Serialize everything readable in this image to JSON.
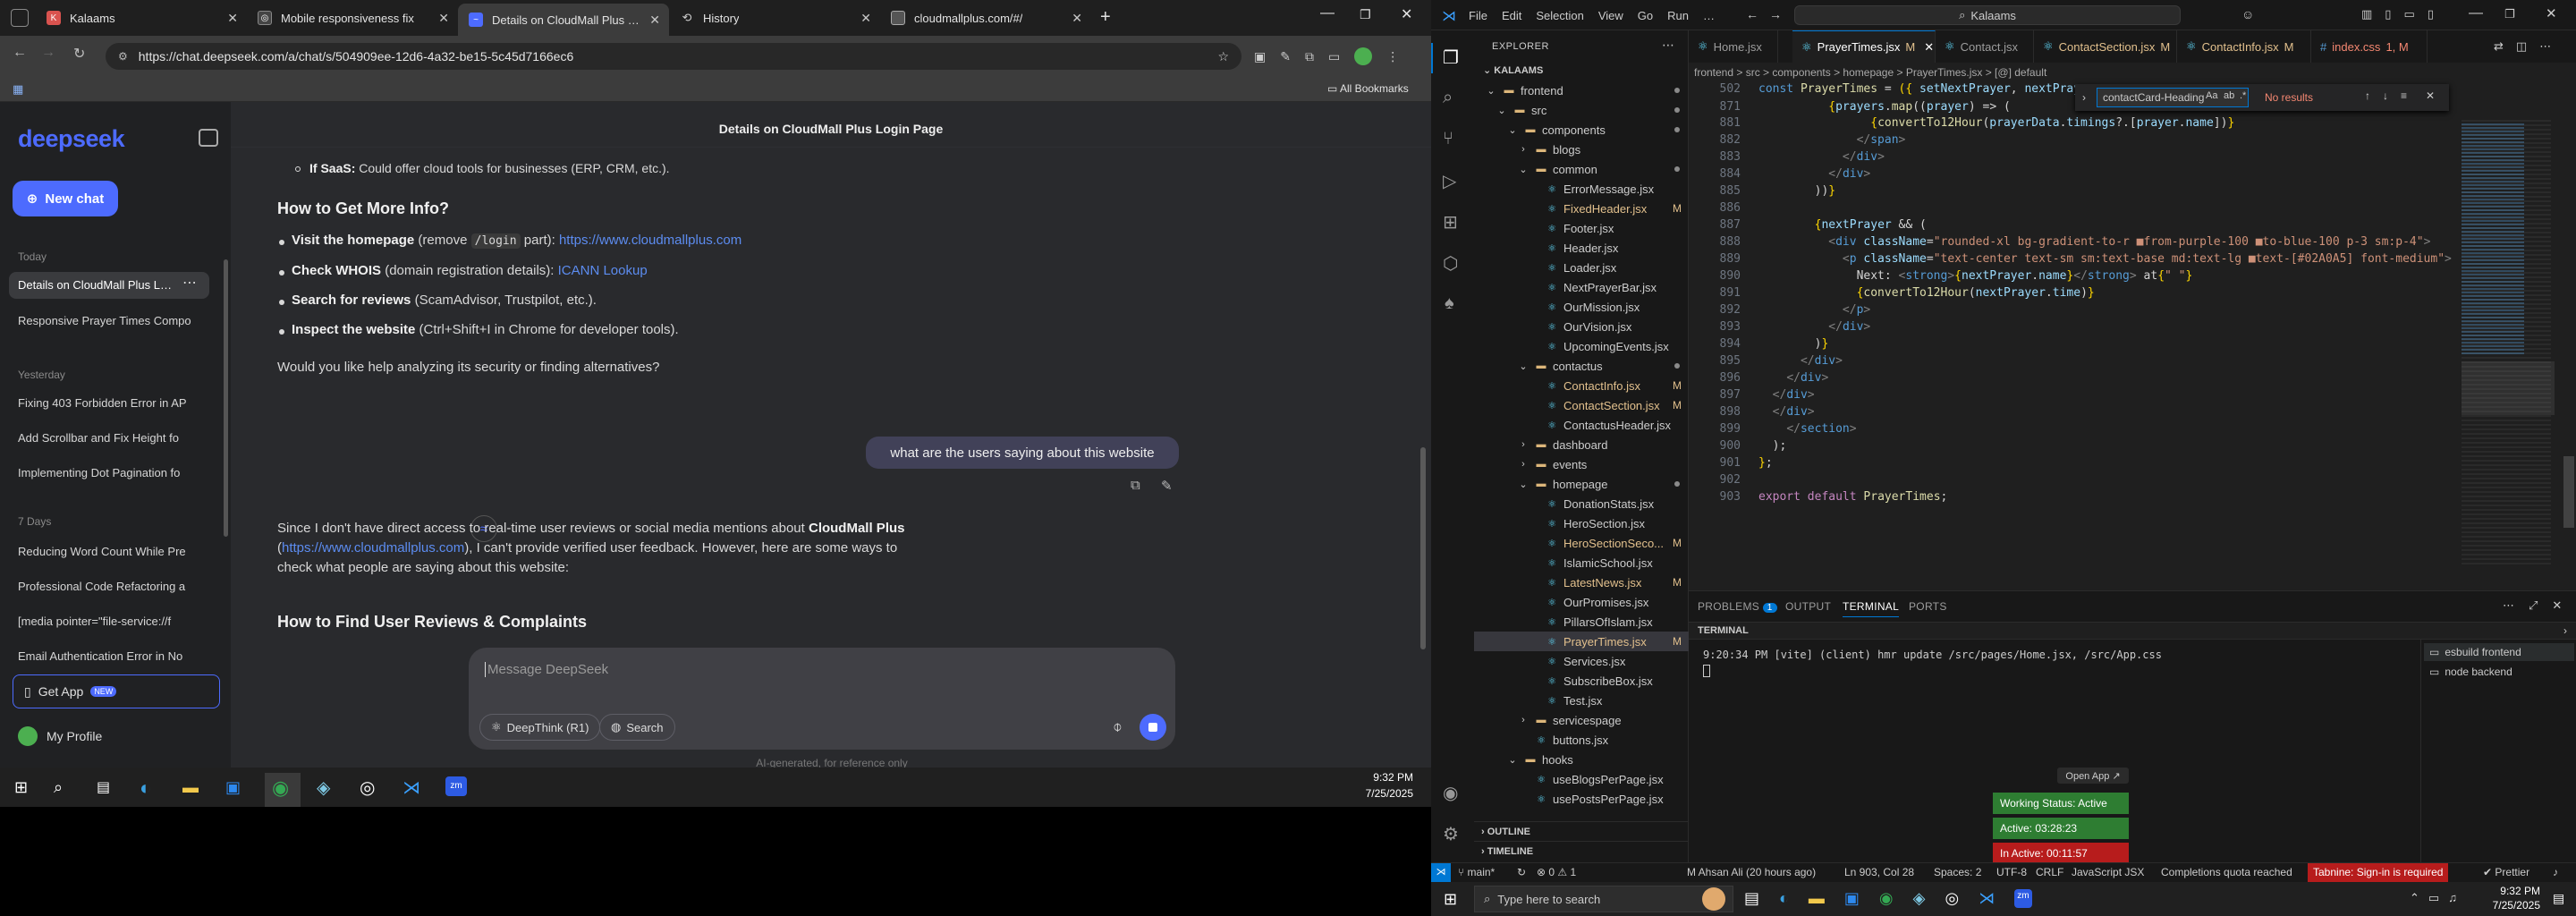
{
  "chrome": {
    "tabs": [
      {
        "title": "Kalaams"
      },
      {
        "title": "Mobile responsiveness fix"
      },
      {
        "title": "Details on CloudMall Plus Login Page"
      },
      {
        "title": "History"
      },
      {
        "title": "cloudmallplus.com/#/"
      }
    ],
    "url": "https://chat.deepseek.com/a/chat/s/504909ee-12d6-4a32-be15-5c45d7166ec6",
    "bookmarks_label": "All Bookmarks"
  },
  "deepseek": {
    "logo": "deepseek",
    "new_chat": "New chat",
    "sections": {
      "today": "Today",
      "yesterday": "Yesterday",
      "week": "7 Days"
    },
    "today_chats": [
      "Details on CloudMall Plus Login",
      "Responsive Prayer Times Compo"
    ],
    "yesterday_chats": [
      "Fixing 403 Forbidden Error in AP",
      "Add Scrollbar and Fix Height fo",
      "Implementing Dot Pagination fo"
    ],
    "week_chats": [
      "Reducing Word Count While Pre",
      "Professional Code Refactoring a",
      "[media pointer=\"file-service://f",
      "Email Authentication Error in No"
    ],
    "get_app": "Get App",
    "new_badge": "NEW",
    "profile": "My Profile",
    "chat_title": "Details on CloudMall Plus Login Page",
    "saas_line_bold": "If SaaS:",
    "saas_line": " Could offer cloud tools for businesses (ERP, CRM, etc.).",
    "heading1": "How to Get More Info?",
    "b1_bold": "Visit the homepage",
    "b1_a": " (remove ",
    "b1_code": "/login",
    "b1_b": " part): ",
    "b1_link": "https://www.cloudmallplus.com",
    "b2_bold": "Check WHOIS",
    "b2_a": " (domain registration details): ",
    "b2_link": "ICANN Lookup",
    "b3_bold": "Search for reviews",
    "b3_a": " (ScamAdvisor, Trustpilot, etc.).",
    "b4_bold": "Inspect the website",
    "b4_a": " (Ctrl+Shift+I in Chrome for developer tools).",
    "question": "Would you like help analyzing its security or finding alternatives?",
    "user_msg": "what are the users saying about this website",
    "reply_a": "Since I don't have direct access to real-time user reviews or social media mentions about ",
    "reply_bold": "CloudMall Plus",
    "reply_b1": "(",
    "reply_link": "https://www.cloudmallplus.com",
    "reply_b2": "), I can't provide verified user feedback. However, here are some ways to",
    "reply_c": "check what people are saying about this website:",
    "heading2": "How to Find User Reviews & Complaints",
    "input_placeholder": "Message DeepSeek",
    "deepthink": "DeepThink (R1)",
    "search": "Search",
    "footer": "AI-generated, for reference only"
  },
  "taskbar_left": {
    "time": "9:32 PM",
    "date": "7/25/2025"
  },
  "vscode": {
    "title_search": "Kalaams",
    "menu": [
      "File",
      "Edit",
      "Selection",
      "View",
      "Go",
      "Run",
      "…"
    ],
    "explorer_label": "EXPLORER",
    "root": "KALAAMS",
    "tree": [
      {
        "name": "frontend",
        "type": "folder",
        "depth": 1,
        "open": true,
        "dot": true
      },
      {
        "name": "src",
        "type": "folder",
        "depth": 2,
        "open": true,
        "dot": true
      },
      {
        "name": "components",
        "type": "folder",
        "depth": 3,
        "open": true,
        "dot": true
      },
      {
        "name": "blogs",
        "type": "folder",
        "depth": 4,
        "open": false
      },
      {
        "name": "common",
        "type": "folder",
        "depth": 4,
        "open": true,
        "dot": true
      },
      {
        "name": "ErrorMessage.jsx",
        "type": "file",
        "depth": 5
      },
      {
        "name": "FixedHeader.jsx",
        "type": "file",
        "depth": 5,
        "mod": "M"
      },
      {
        "name": "Footer.jsx",
        "type": "file",
        "depth": 5
      },
      {
        "name": "Header.jsx",
        "type": "file",
        "depth": 5
      },
      {
        "name": "Loader.jsx",
        "type": "file",
        "depth": 5
      },
      {
        "name": "NextPrayerBar.jsx",
        "type": "file",
        "depth": 5
      },
      {
        "name": "OurMission.jsx",
        "type": "file",
        "depth": 5
      },
      {
        "name": "OurVision.jsx",
        "type": "file",
        "depth": 5
      },
      {
        "name": "UpcomingEvents.jsx",
        "type": "file",
        "depth": 5
      },
      {
        "name": "contactus",
        "type": "folder",
        "depth": 4,
        "open": true,
        "dot": true
      },
      {
        "name": "ContactInfo.jsx",
        "type": "file",
        "depth": 5,
        "mod": "M"
      },
      {
        "name": "ContactSection.jsx",
        "type": "file",
        "depth": 5,
        "mod": "M"
      },
      {
        "name": "ContactusHeader.jsx",
        "type": "file",
        "depth": 5
      },
      {
        "name": "dashboard",
        "type": "folder",
        "depth": 4,
        "open": false
      },
      {
        "name": "events",
        "type": "folder",
        "depth": 4,
        "open": false
      },
      {
        "name": "homepage",
        "type": "folder",
        "depth": 4,
        "open": true,
        "dot": true
      },
      {
        "name": "DonationStats.jsx",
        "type": "file",
        "depth": 5
      },
      {
        "name": "HeroSection.jsx",
        "type": "file",
        "depth": 5
      },
      {
        "name": "HeroSectionSeco...",
        "type": "file",
        "depth": 5,
        "mod": "M"
      },
      {
        "name": "IslamicSchool.jsx",
        "type": "file",
        "depth": 5
      },
      {
        "name": "LatestNews.jsx",
        "type": "file",
        "depth": 5,
        "mod": "M"
      },
      {
        "name": "OurPromises.jsx",
        "type": "file",
        "depth": 5
      },
      {
        "name": "PillarsOfIslam.jsx",
        "type": "file",
        "depth": 5
      },
      {
        "name": "PrayerTimes.jsx",
        "type": "file",
        "depth": 5,
        "mod": "M",
        "selected": true
      },
      {
        "name": "Services.jsx",
        "type": "file",
        "depth": 5
      },
      {
        "name": "SubscribeBox.jsx",
        "type": "file",
        "depth": 5
      },
      {
        "name": "Test.jsx",
        "type": "file",
        "depth": 5
      },
      {
        "name": "servicespage",
        "type": "folder",
        "depth": 4,
        "open": false
      },
      {
        "name": "buttons.jsx",
        "type": "file",
        "depth": 4
      },
      {
        "name": "hooks",
        "type": "folder",
        "depth": 3,
        "open": true
      },
      {
        "name": "useBlogsPerPage.jsx",
        "type": "file",
        "depth": 4
      },
      {
        "name": "usePostsPerPage.jsx",
        "type": "file",
        "depth": 4
      }
    ],
    "outline": "OUTLINE",
    "timeline": "TIMELINE",
    "tabs": [
      {
        "name": "Home.jsx",
        "mod": ""
      },
      {
        "name": "PrayerTimes.jsx",
        "mod": "M"
      },
      {
        "name": "Contact.jsx",
        "mod": ""
      },
      {
        "name": "ContactSection.jsx",
        "mod": "M"
      },
      {
        "name": "ContactInfo.jsx",
        "mod": "M"
      },
      {
        "name": "index.css",
        "mod": "1, M"
      }
    ],
    "breadcrumb": "frontend > src > components > homepage > PrayerTimes.jsx > [@] default",
    "find_text": "contactCard-Heading",
    "find_result": "No results",
    "panel_tabs": [
      "PROBLEMS",
      "OUTPUT",
      "TERMINAL",
      "PORTS"
    ],
    "problems_count": "1",
    "terminal_label": "TERMINAL",
    "terminal_line": "9:20:34 PM [vite] (client) hmr update /src/pages/Home.jsx, /src/App.css",
    "terminal_tabs": [
      "esbuild frontend",
      "node backend"
    ],
    "status": {
      "branch": "main*",
      "errors": "⊗ 0 ⚠ 1",
      "blame": "M Ahsan Ali (20 hours ago)",
      "pos": "Ln 903, Col 28",
      "spaces": "Spaces: 2",
      "encoding": "UTF-8",
      "eol": "CRLF",
      "lang": "JavaScript JSX",
      "completions": "Completions quota reached",
      "tabnine": "Tabnine: Sign-in is required",
      "prettier": "✔ Prettier"
    },
    "widget": {
      "open": "Open App ↗",
      "status": "Working Status: Active",
      "active": "Active: 03:28:23",
      "inactive": "In Active: 00:11:57"
    }
  },
  "taskbar_right": {
    "search": "Type here to search",
    "time": "9:32 PM",
    "date": "7/25/2025"
  }
}
